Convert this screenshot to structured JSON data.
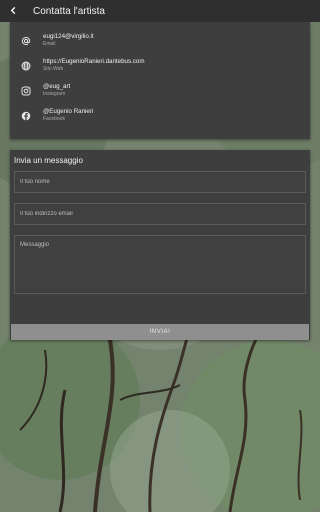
{
  "header": {
    "back_icon": "arrow-left-icon",
    "title": "Contatta l'artista"
  },
  "contacts": [
    {
      "icon": "at-icon",
      "value": "eugi124@virgilio.it",
      "label": "Email"
    },
    {
      "icon": "globe-icon",
      "value": "https://EugenioRanieri.dantebus.com",
      "label": "Sito Web"
    },
    {
      "icon": "instagram-icon",
      "value": "@eug_art",
      "label": "Instagram"
    },
    {
      "icon": "facebook-icon",
      "value": "@Eugenio Ranieri",
      "label": "Facebook"
    }
  ],
  "form": {
    "title": "Invia un messaggio",
    "name_placeholder": "Il tuo nome",
    "email_placeholder": "Il tuo indirizzo email",
    "message_placeholder": "Messaggio",
    "send_label": "INVIA!"
  },
  "colors": {
    "topbar": "#2f2f2f",
    "card": "#3e3e3e",
    "button": "#8f8f8f"
  }
}
